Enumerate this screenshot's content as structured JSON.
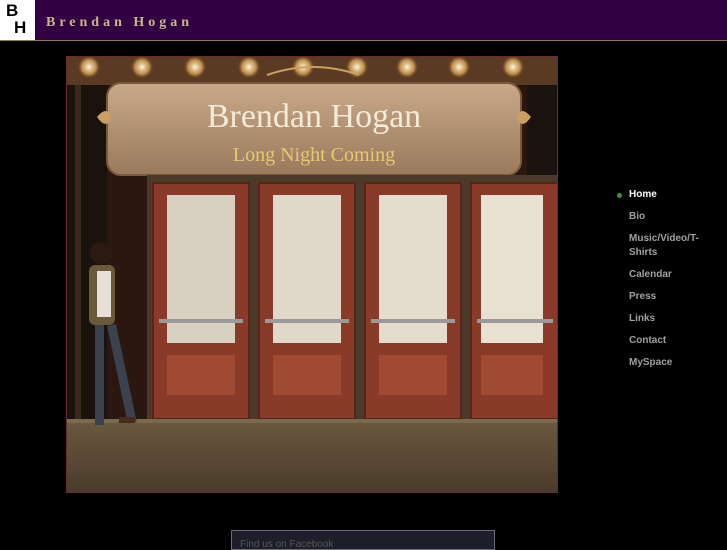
{
  "header": {
    "logo_b": "B",
    "logo_h": "H",
    "site_title": "Brendan Hogan"
  },
  "hero": {
    "marquee_title": "Brendan Hogan",
    "marquee_subtitle": "Long Night Coming"
  },
  "nav": {
    "items": [
      {
        "label": "Home",
        "active": true
      },
      {
        "label": "Bio"
      },
      {
        "label": "Music/Video/T-Shirts"
      },
      {
        "label": "Calendar"
      },
      {
        "label": "Press"
      },
      {
        "label": "Links"
      },
      {
        "label": "Contact"
      },
      {
        "label": "MySpace"
      }
    ]
  },
  "footer_widget": {
    "label": "Find us on Facebook"
  }
}
